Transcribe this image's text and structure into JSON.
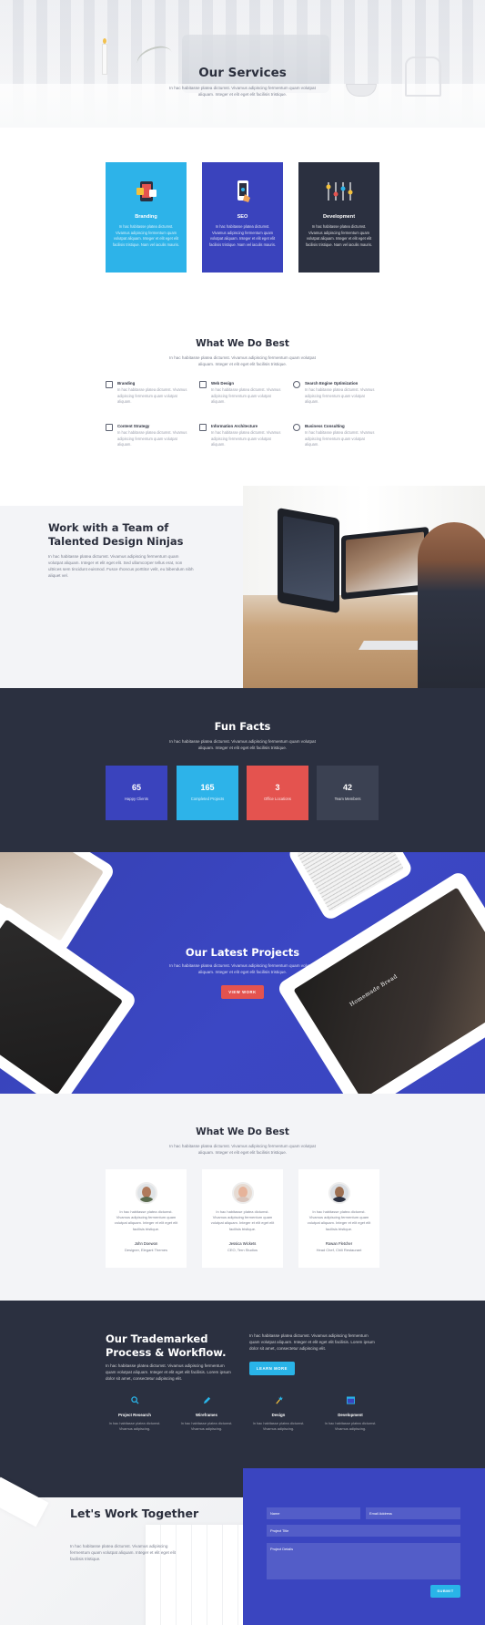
{
  "hero": {
    "title": "Our Services",
    "subtitle": "In hac habitasse platea dictumst. Vivamus adipiscing fermentum quam volutpat aliquam. Integer et elit eget elit facilisis tristique."
  },
  "services": [
    {
      "label": "Branding",
      "icon": "phone-app-icon",
      "color": "#2db3e9",
      "text": "In hac habitasse platea dictumst. Vivamus adipiscing fermentum quam volutpat aliquam. Integer et elit eget elit facilisis tristique. Nam vel iaculis mauris."
    },
    {
      "label": "SEO",
      "icon": "mobile-touch-icon",
      "color": "#3a43bd",
      "text": "In hac habitasse platea dictumst. Vivamus adipiscing fermentum quam volutpat aliquam. Integer et elit eget elit facilisis tristique. Nam vel iaculis mauris."
    },
    {
      "label": "Development",
      "icon": "sliders-icon",
      "color": "#2b3040",
      "text": "In hac habitasse platea dictumst. Vivamus adipiscing fermentum quam volutpat aliquam. Integer et elit eget elit facilisis tristique. Nam vel iaculis mauris."
    }
  ],
  "best": {
    "title": "What We Do Best",
    "subtitle": "In hac habitasse platea dictumst. Vivamus adipiscing fermentum quam volutpat aliquam. Integer et elit eget elit facilisis tristique.",
    "features": [
      {
        "name": "Branding",
        "icon": "pen-icon",
        "text": "In hac habitasse platea dictumst. Vivamus adipiscing fermentum quam volutpat aliquam."
      },
      {
        "name": "Web Design",
        "icon": "monitor-icon",
        "text": "In hac habitasse platea dictumst. Vivamus adipiscing fermentum quam volutpat aliquam."
      },
      {
        "name": "Search Engine Optimization",
        "icon": "chat-icon",
        "text": "In hac habitasse platea dictumst. Vivamus adipiscing fermentum quam volutpat aliquam."
      },
      {
        "name": "Content Strategy",
        "icon": "document-icon",
        "text": "In hac habitasse platea dictumst. Vivamus adipiscing fermentum quam volutpat aliquam."
      },
      {
        "name": "Information Architecture",
        "icon": "sitemap-icon",
        "text": "In hac habitasse platea dictumst. Vivamus adipiscing fermentum quam volutpat aliquam."
      },
      {
        "name": "Business Consulting",
        "icon": "lightbulb-icon",
        "text": "In hac habitasse platea dictumst. Vivamus adipiscing fermentum quam volutpat aliquam."
      }
    ]
  },
  "team": {
    "title": "Work with a Team of Talented Design Ninjas",
    "text": "In hac habitasse platea dictumst. Vivamus adipiscing fermentum quam volutpat aliquam. Integer et elit eget elit. Sed ullamcorper tellus erat, non ultrices sem tincidunt euismod. Fusce rhoncus porttitor velit, eu bibendum nibh aliquet vel."
  },
  "facts": {
    "title": "Fun Facts",
    "subtitle": "In hac habitasse platea dictumst. Vivamus adipiscing fermentum quam volutpat aliquam. Integer et elit eget elit facilisis tristique.",
    "items": [
      {
        "value": "65",
        "label": "Happy Clients",
        "color": "#3a43bd"
      },
      {
        "value": "165",
        "label": "Completed Projects",
        "color": "#2db3e9"
      },
      {
        "value": "3",
        "label": "Office Locations",
        "color": "#e4534f"
      },
      {
        "value": "42",
        "label": "Team Members",
        "color": "#3b4152"
      }
    ]
  },
  "projects": {
    "title": "Our Latest Projects",
    "subtitle": "In hac habitasse platea dictumst. Vivamus adipiscing fermentum quam volutpat aliquam. Integer et elit eget elit facilisis tristique.",
    "button": "VIEW WORK",
    "tablet_caption": "Homemade Bread"
  },
  "testimonials": {
    "title": "What We Do Best",
    "subtitle": "In hac habitasse platea dictumst. Vivamus adipiscing fermentum quam volutpat aliquam. Integer et elit eget elit facilisis tristique.",
    "items": [
      {
        "quote": "In hac habitasse platea dictumst. Vivamus adipiscing fermentum quam volutpat aliquam. Integer et elit eget elit facilisis tristique.",
        "name": "John Doewon",
        "role": "Designer, Elegant Themes"
      },
      {
        "quote": "In hac habitasse platea dictumst. Vivamus adipiscing fermentum quam volutpat aliquam. Integer et elit eget elit facilisis tristique.",
        "name": "Jessica Wickets",
        "role": "CEO, Tern Studios"
      },
      {
        "quote": "In hac habitasse platea dictumst. Vivamus adipiscing fermentum quam volutpat aliquam. Integer et elit eget elit facilisis tristique.",
        "name": "Rowan Fletcher",
        "role": "Head Chef, Chili Restaurant"
      }
    ]
  },
  "process": {
    "title": "Our Trademarked Process & Workflow.",
    "text1": "In hac habitasse platea dictumst. Vivamus adipiscing fermentum quam volutpat aliquam. Integer et elit eget elit facilisis. Lorem ipsum dolor sit amet, consectetur adipiscing elit.",
    "text2": "In hac habitasse platea dictumst. Vivamus adipiscing fermentum quam volutpat aliquam. Integer et elit eget elit facilisis. Lorem ipsum dolor sit amet, consectetur adipiscing elit.",
    "button": "LEARN MORE",
    "steps": [
      {
        "name": "Project Research",
        "icon": "search-icon",
        "text": "In hac habitasse platea dictumst. Vivamus adipiscing."
      },
      {
        "name": "Wireframes",
        "icon": "pencil-icon",
        "text": "In hac habitasse platea dictumst. Vivamus adipiscing."
      },
      {
        "name": "Design",
        "icon": "magic-wand-icon",
        "text": "In hac habitasse platea dictumst. Vivamus adipiscing."
      },
      {
        "name": "Development",
        "icon": "browser-window-icon",
        "text": "In hac habitasse platea dictumst. Vivamus adipiscing."
      }
    ]
  },
  "contact": {
    "title": "Let's Work Together",
    "text": "In hac habitasse platea dictumst. Vivamus adipiscing fermentum quam volutpat aliquam. Integer et elit eget elit facilisis tristique.",
    "fields": {
      "name": "Name",
      "email": "Email Address",
      "project_title": "Project Title",
      "project_details": "Project Details"
    },
    "button": "SUBMIT"
  }
}
